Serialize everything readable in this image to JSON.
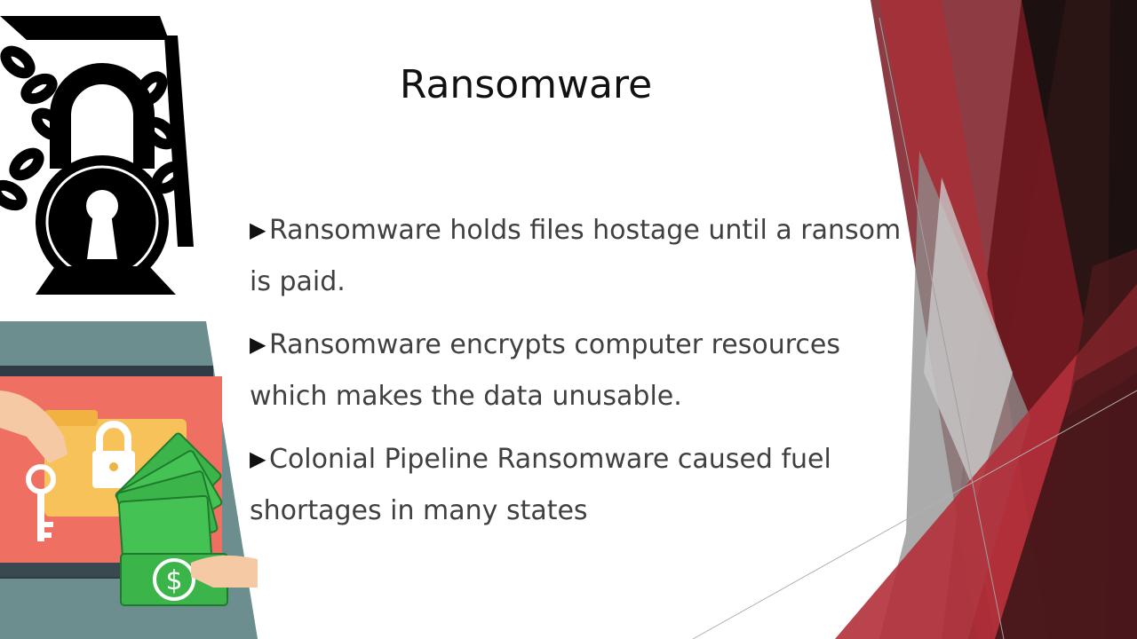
{
  "slide": {
    "title": "Ransomware",
    "bullets": [
      {
        "marker": "▶",
        "text": "Ransomware holds files hostage until a ransom is paid."
      },
      {
        "marker": "▶",
        "text": "Ransomware encrypts computer resources which makes the data unusable."
      },
      {
        "marker": "▶",
        "text": "Colonial Pipeline Ransomware caused fuel shortages in many states"
      }
    ]
  },
  "images": {
    "padlock": {
      "icon": "chained-padlock-icon"
    },
    "illustration": {
      "icon": "ransom-laptop-money-illustration",
      "currency_symbol": "$"
    }
  },
  "colors": {
    "accent_red": "#a3303a",
    "dark_red": "#3b1214",
    "gray": "#8c8c8c",
    "text": "#404040"
  }
}
